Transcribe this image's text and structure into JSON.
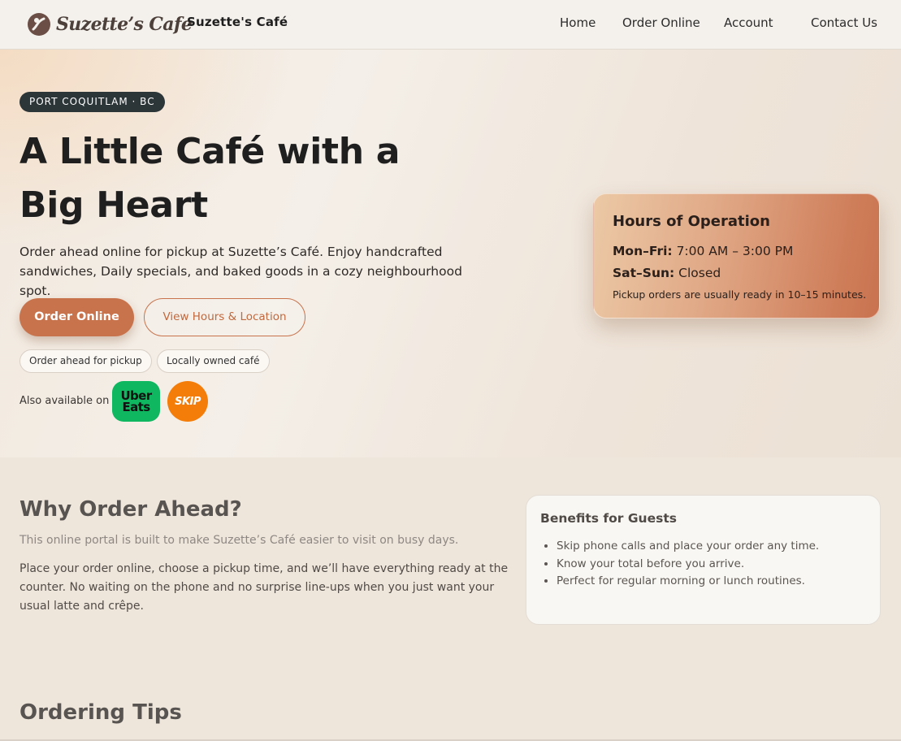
{
  "header": {
    "logo_text": "Suzette’s Cafe",
    "brand_title": "Suzette's Café",
    "nav": {
      "home": "Home",
      "order_online": "Order Online",
      "account": "Account",
      "contact_us": "Contact Us"
    }
  },
  "hero": {
    "location_badge": "PORT COQUITLAM · BC",
    "title": "A Little Café with a Big Heart",
    "description": "Order ahead online for pickup at Suzette’s Café. Enjoy handcrafted sandwiches, Daily specials, and baked goods in a cozy neighbourhood spot.",
    "primary_button": "Order Online",
    "secondary_button": "View Hours & Location",
    "pills": [
      "Order ahead for pickup",
      "Locally owned café"
    ],
    "also_available_label": "Also available on",
    "delivery_apps": [
      {
        "label_line1": "Uber",
        "label_line2": "Eats",
        "color": "#0fb761"
      },
      {
        "label": "SKIP",
        "color": "#f47d0a"
      }
    ]
  },
  "hours": {
    "title": "Hours of Operation",
    "weekday_label": "Mon–Fri:",
    "weekday_value": "7:00 AM – 3:00 PM",
    "weekend_label": "Sat–Sun:",
    "weekend_value": "Closed",
    "note": "Pickup orders are usually ready in 10–15 minutes."
  },
  "why": {
    "title": "Why Order Ahead?",
    "subtitle": "This online portal is built to make Suzette’s Café easier to visit on busy days.",
    "body": "Place your order online, choose a pickup time, and we’ll have everything ready at the counter. No waiting on the phone and no surprise line-ups when you just want your usual latte and crêpe."
  },
  "benefits": {
    "title": "Benefits for Guests",
    "items": [
      "Skip phone calls and place your order any time.",
      "Know your total before you arrive.",
      "Perfect for regular morning or lunch routines."
    ]
  },
  "tips": {
    "title": "Ordering Tips"
  },
  "colors": {
    "accent": "#c8734c",
    "badge_bg": "#2c3538",
    "page_bg": "#efe6db"
  }
}
